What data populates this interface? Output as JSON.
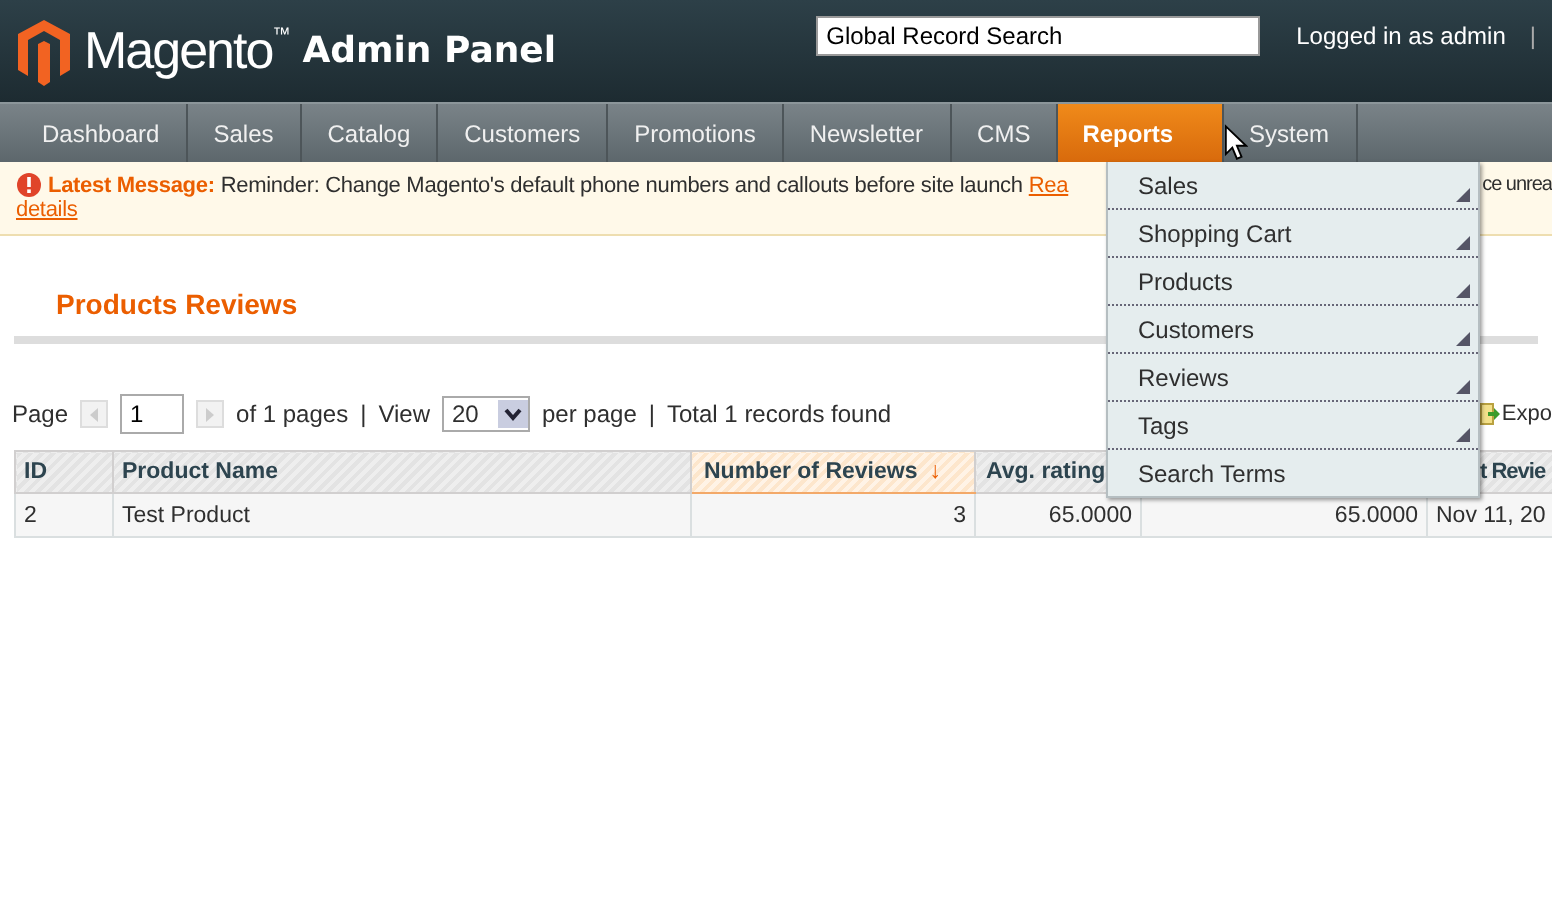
{
  "header": {
    "brand": "Magento",
    "trademark": "™",
    "product": "Admin Panel",
    "search": {
      "value": "Global Record Search"
    },
    "user": "Logged in as admin",
    "separator": "|"
  },
  "nav": [
    {
      "label": "Dashboard",
      "selected": false
    },
    {
      "label": "Sales",
      "selected": false
    },
    {
      "label": "Catalog",
      "selected": false
    },
    {
      "label": "Customers",
      "selected": false
    },
    {
      "label": "Promotions",
      "selected": false
    },
    {
      "label": "Newsletter",
      "selected": false
    },
    {
      "label": "CMS",
      "selected": false
    },
    {
      "label": "Reports",
      "selected": true
    },
    {
      "label": "System",
      "selected": false
    }
  ],
  "reports_menu": [
    {
      "label": "Sales",
      "has_submenu": true
    },
    {
      "label": "Shopping Cart",
      "has_submenu": true
    },
    {
      "label": "Products",
      "has_submenu": true
    },
    {
      "label": "Customers",
      "has_submenu": true
    },
    {
      "label": "Reviews",
      "has_submenu": true
    },
    {
      "label": "Tags",
      "has_submenu": true
    },
    {
      "label": "Search Terms",
      "has_submenu": false
    }
  ],
  "message": {
    "label": "Latest Message:",
    "text": "Reminder: Change Magento's default phone numbers and callouts before site launch",
    "link": "Rea",
    "tail": "ce unrea",
    "details_link": "details"
  },
  "page_title": "Products Reviews",
  "pager": {
    "page_label": "Page",
    "page": "1",
    "of_pages": "of 1 pages",
    "sep": "|",
    "view_label": "View",
    "per_page": "20",
    "per_page_label": "per page",
    "sep2": "|",
    "total": "Total 1 records found",
    "export": "Expo"
  },
  "table": {
    "columns": [
      {
        "label": "ID",
        "sorted": false
      },
      {
        "label": "Product Name",
        "sorted": false
      },
      {
        "label": "Number of Reviews",
        "sorted": true,
        "sort_arrow": "↓"
      },
      {
        "label": "Avg. rating",
        "sorted": false
      },
      null,
      {
        "label": "t Revie",
        "sorted": false
      }
    ],
    "rows": [
      [
        "2",
        "Test Product",
        "3",
        "65.0000",
        "65.0000",
        "Nov 11, 20"
      ]
    ]
  }
}
